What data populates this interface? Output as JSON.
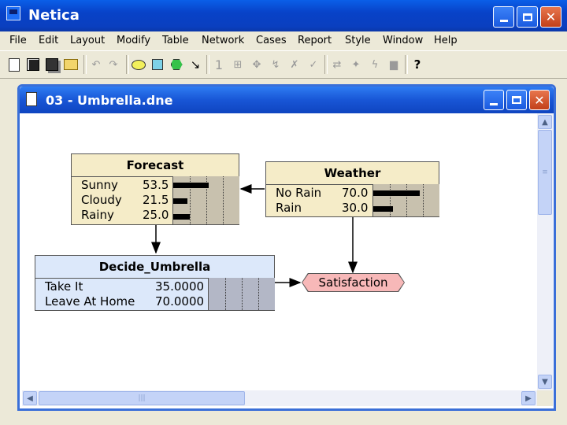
{
  "app": {
    "title": "Netica"
  },
  "menu": [
    "File",
    "Edit",
    "Layout",
    "Modify",
    "Table",
    "Network",
    "Cases",
    "Report",
    "Style",
    "Window",
    "Help"
  ],
  "toolbar": {
    "icons": [
      "new-file-icon",
      "save-icon",
      "save-all-icon",
      "open-folder-icon",
      "undo-icon",
      "redo-icon",
      "nature-node-icon",
      "decision-node-icon",
      "utility-node-icon",
      "arrow-tool-icon",
      "compile-icon",
      "network-icon",
      "absorb-icon",
      "reverse-link-icon",
      "remove-icon",
      "check-icon",
      "swap-icon",
      "select-icon",
      "lightning-icon",
      "notes-icon",
      "help-icon"
    ],
    "compile_label": "1",
    "help_label": "?"
  },
  "document": {
    "title": "03 - Umbrella.dne"
  },
  "nodes": {
    "forecast": {
      "name": "Forecast",
      "states": [
        {
          "label": "Sunny",
          "value": "53.5",
          "belief": 53.5
        },
        {
          "label": "Cloudy",
          "value": "21.5",
          "belief": 21.5
        },
        {
          "label": "Rainy",
          "value": "25.0",
          "belief": 25.0
        }
      ]
    },
    "weather": {
      "name": "Weather",
      "states": [
        {
          "label": "No Rain",
          "value": "70.0",
          "belief": 70.0
        },
        {
          "label": "Rain",
          "value": "30.0",
          "belief": 30.0
        }
      ]
    },
    "decide_umbrella": {
      "name": "Decide_Umbrella",
      "states": [
        {
          "label": "Take It",
          "value": "35.0000"
        },
        {
          "label": "Leave At Home",
          "value": "70.0000"
        }
      ]
    },
    "satisfaction": {
      "name": "Satisfaction"
    }
  },
  "scroll": {
    "v_grip": "≡",
    "h_grip": "|||"
  },
  "colors": {
    "nature_node_fill": "#f5ecc8",
    "decision_node_fill": "#dce8fa",
    "utility_node_fill": "#f7b8b8",
    "bar_area": "#c8c1ae",
    "decision_bar_area": "#b3b7c6",
    "titlebar": "#0842c8"
  }
}
